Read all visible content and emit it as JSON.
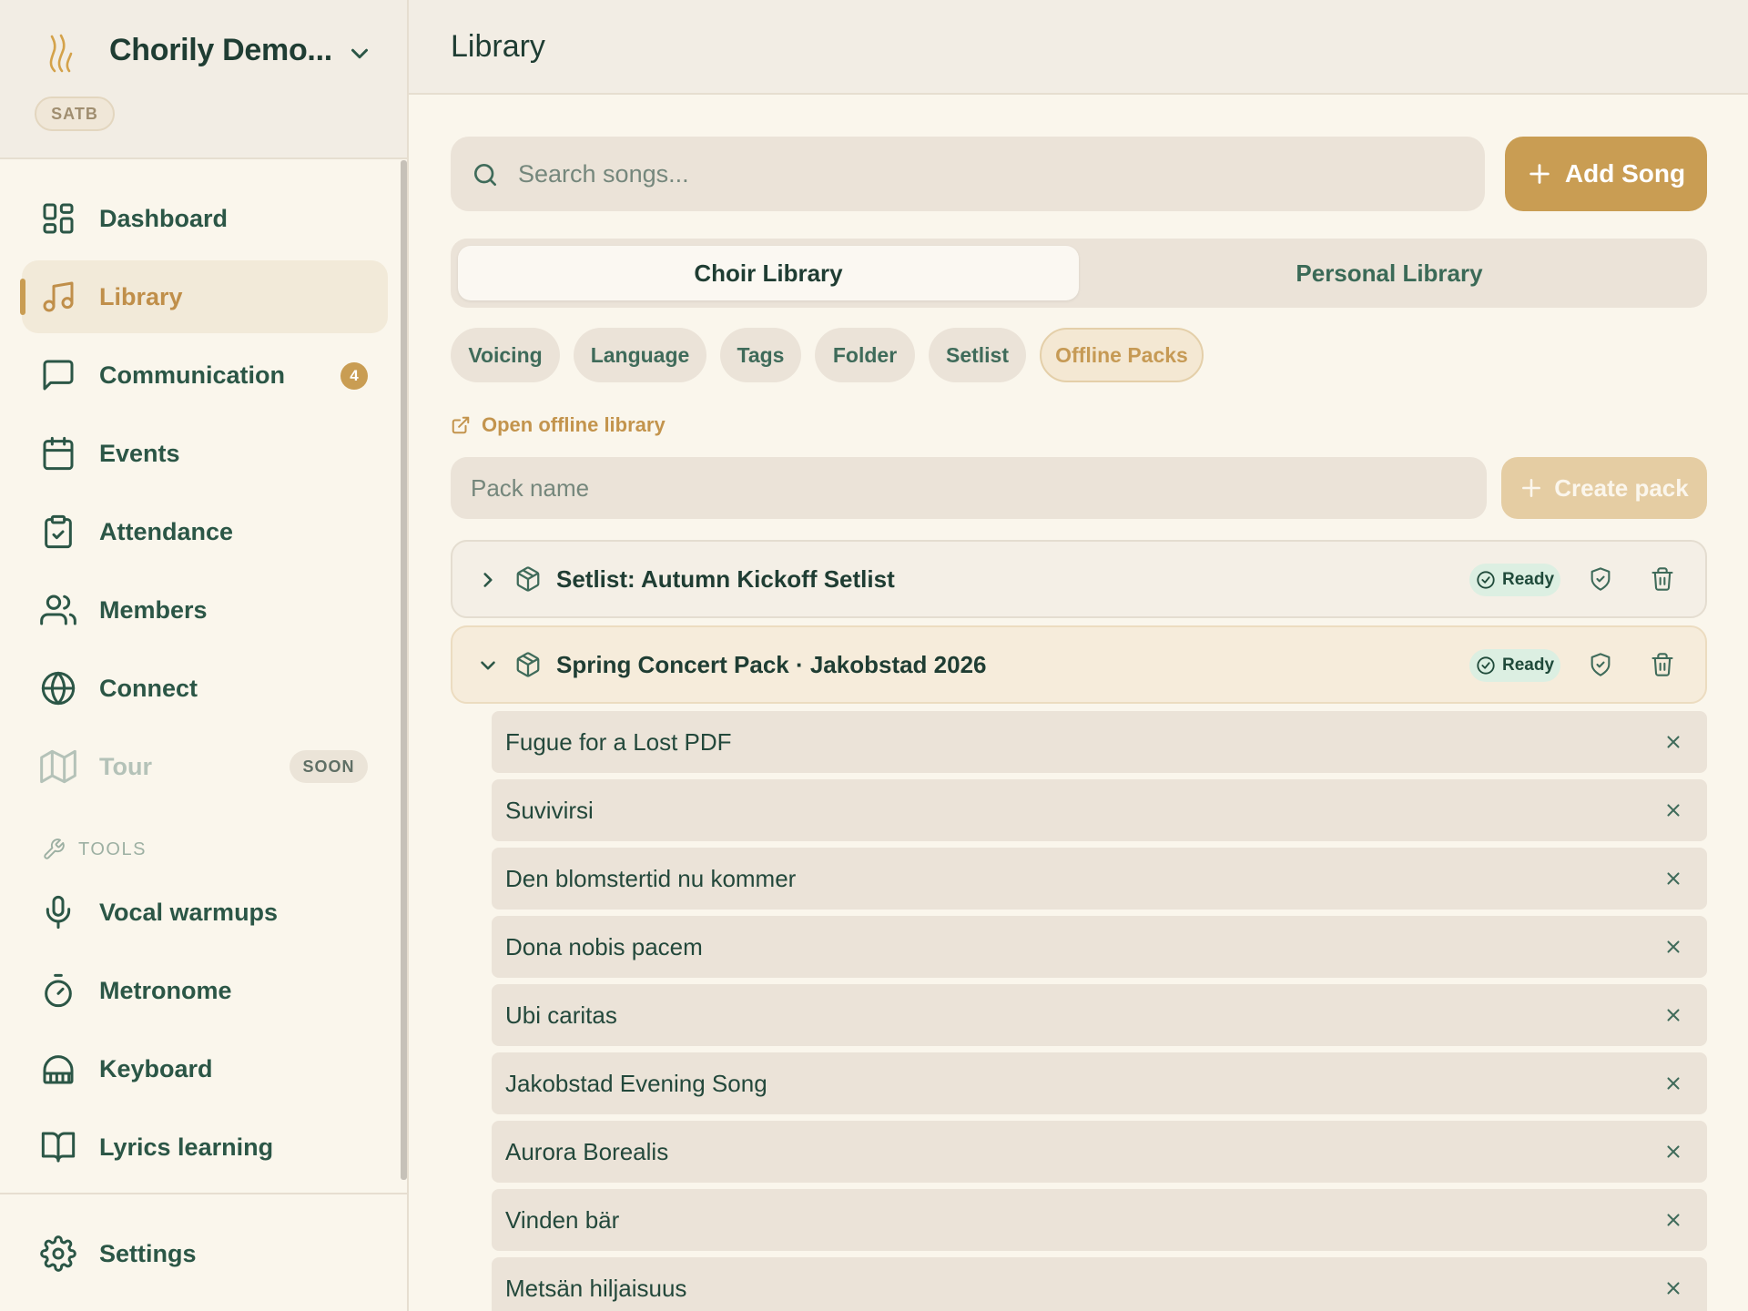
{
  "sidebar": {
    "choir_name": "Chorily Demo...",
    "voicing": "SATB",
    "nav": {
      "dashboard": "Dashboard",
      "library": "Library",
      "communication": "Communication",
      "communication_count": "4",
      "events": "Events",
      "attendance": "Attendance",
      "members": "Members",
      "connect": "Connect",
      "tour": "Tour",
      "tour_badge": "SOON"
    },
    "tools_header": "TOOLS",
    "tools": {
      "vocal_warmups": "Vocal warmups",
      "metronome": "Metronome",
      "keyboard": "Keyboard",
      "lyrics_learning": "Lyrics learning"
    },
    "settings": "Settings",
    "active_item": "Library"
  },
  "header": {
    "title": "Library"
  },
  "search": {
    "placeholder": "Search songs...",
    "value": ""
  },
  "actions": {
    "add_song": "Add Song"
  },
  "tabs": {
    "choir": "Choir Library",
    "personal": "Personal Library",
    "active": "Choir Library"
  },
  "filters": {
    "voicing": "Voicing",
    "language": "Language",
    "tags": "Tags",
    "folder": "Folder",
    "setlist": "Setlist",
    "offline_packs": "Offline Packs",
    "active": "Offline Packs"
  },
  "offline": {
    "open_link": "Open offline library",
    "pack_name_placeholder": "Pack name",
    "create_pack": "Create pack",
    "packs": [
      {
        "title": "Setlist: Autumn Kickoff Setlist",
        "status": "Ready",
        "expanded": false
      },
      {
        "title": "Spring Concert Pack · Jakobstad 2026",
        "status": "Ready",
        "expanded": true
      }
    ],
    "songs": [
      "Fugue for a Lost PDF",
      "Suvivirsi",
      "Den blomstertid nu kommer",
      "Dona nobis pacem",
      "Ubi caritas",
      "Jakobstad Evening Song",
      "Aurora Borealis",
      "Vinden bär",
      "Metsän hiljaisuus"
    ]
  },
  "colors": {
    "accent": "#c99d53",
    "text_primary": "#1f3d33",
    "text_secondary": "#2b5646",
    "background": "#faf6ec",
    "surface": "#ebe3d8",
    "ready_bg": "#dcefe2"
  }
}
